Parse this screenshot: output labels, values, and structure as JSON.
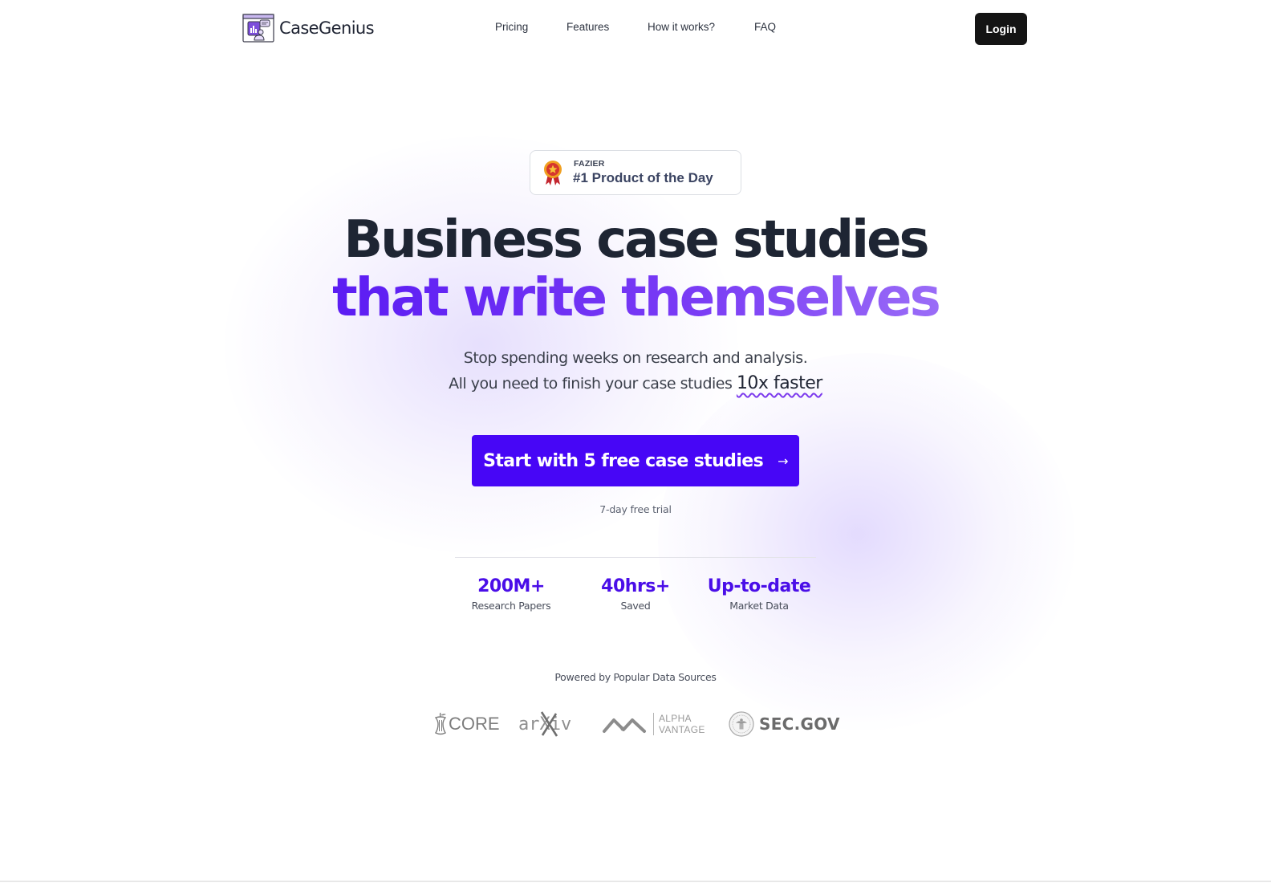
{
  "brand": {
    "name": "CaseGenius",
    "accent_color": "#4706f6",
    "heading_dark_color": "#1e2533"
  },
  "nav": {
    "links": [
      {
        "label": "Pricing"
      },
      {
        "label": "Features"
      },
      {
        "label": "How it works?"
      },
      {
        "label": "FAQ"
      }
    ],
    "login_label": "Login"
  },
  "badge": {
    "icon": "award-ribbon-icon",
    "source": "FAZIER",
    "title": "#1 Product of the Day"
  },
  "hero": {
    "headline_line1": "Business case studies",
    "headline_line2": "that write themselves",
    "subtitle_line1": "Stop spending weeks on research and analysis.",
    "subtitle_line2_prefix": "All you need to finish your case studies ",
    "subtitle_line2_highlight": "10x faster",
    "cta_label": "Start with 5 free case studies",
    "cta_icon": "arrow-right-icon",
    "cta_arrow": "→",
    "trial_note": "7-day free trial"
  },
  "stats": [
    {
      "value": "200M+",
      "label": "Research Papers"
    },
    {
      "value": "40hrs+",
      "label": "Saved"
    },
    {
      "value": "Up-to-date",
      "label": "Market Data"
    }
  ],
  "sources": {
    "heading": "Powered by Popular Data Sources",
    "items": [
      {
        "name": "CORE",
        "icon": "core-logo-icon"
      },
      {
        "name": "arXiv",
        "text": "arXiv",
        "icon": "arxiv-logo-icon"
      },
      {
        "name": "Alpha Vantage",
        "line1": "ALPHA",
        "line2": "VANTAGE",
        "icon": "alpha-vantage-logo-icon"
      },
      {
        "name": "SEC.GOV",
        "icon": "sec-seal-icon"
      }
    ]
  }
}
